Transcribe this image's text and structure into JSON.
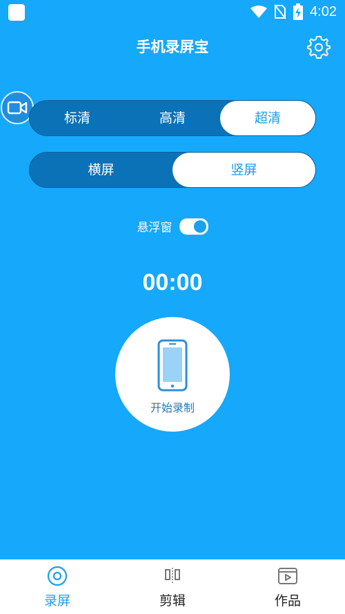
{
  "status_bar": {
    "time": "4:02"
  },
  "header": {
    "title": "手机录屏宝"
  },
  "quality": {
    "options": [
      "标清",
      "高清",
      "超清"
    ],
    "selected": "超清"
  },
  "orientation": {
    "options": [
      "横屏",
      "竖屏"
    ],
    "selected": "竖屏"
  },
  "floating_window": {
    "label": "悬浮窗",
    "enabled": true
  },
  "recorder": {
    "timer": "00:00",
    "start_label": "开始录制"
  },
  "bottom_nav": {
    "items": [
      {
        "label": "录屏",
        "icon": "record-icon",
        "active": true
      },
      {
        "label": "剪辑",
        "icon": "edit-icon",
        "active": false
      },
      {
        "label": "作品",
        "icon": "works-icon",
        "active": false
      }
    ]
  },
  "colors": {
    "background": "#15a8fb",
    "segment_bg": "#0c72b8",
    "selected_text": "#1a9ce8",
    "nav_active": "#1aa0ee",
    "nav_inactive": "#222222"
  }
}
